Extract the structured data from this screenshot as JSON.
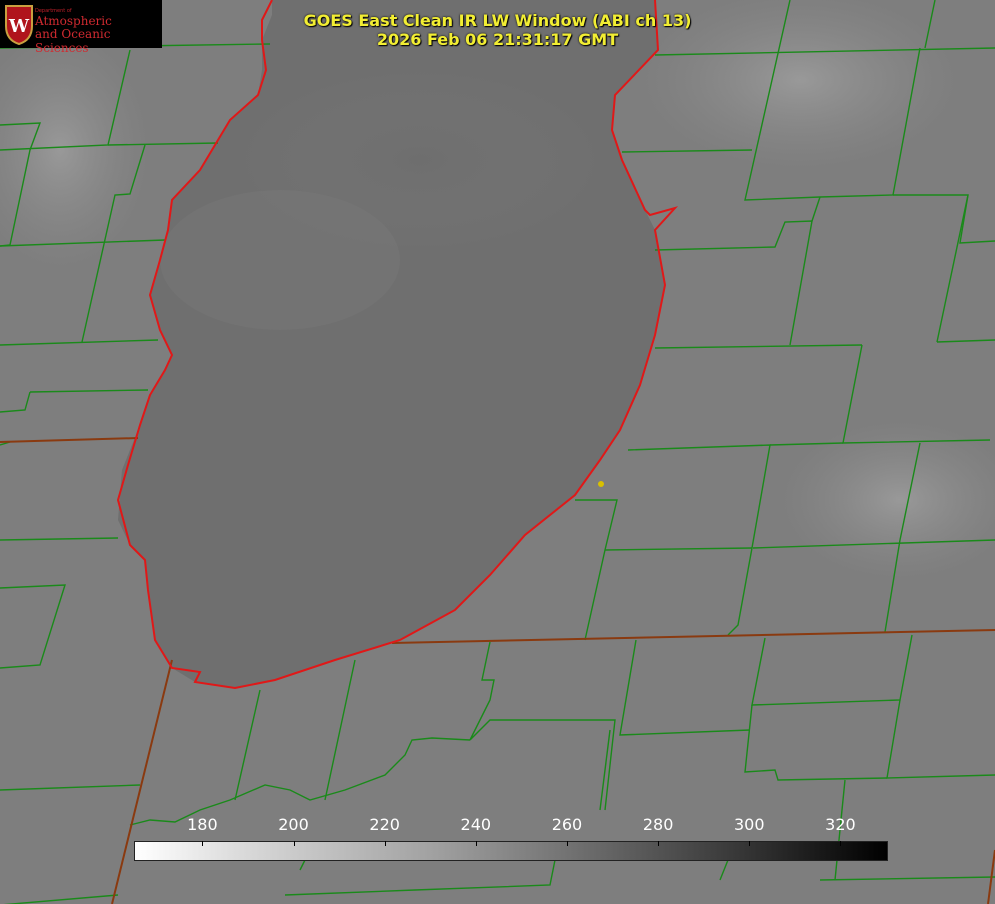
{
  "title": {
    "product": "GOES East Clean IR LW Window (ABI ch 13)",
    "timestamp": "2026 Feb 06 21:31:17 GMT"
  },
  "logo": {
    "dept": "Department of",
    "line1": "Atmospheric",
    "line2": "and Oceanic Sciences"
  },
  "colorbar": {
    "ticks": [
      "180",
      "200",
      "220",
      "240",
      "260",
      "280",
      "300",
      "320"
    ],
    "range": [
      165,
      330
    ],
    "colors": [
      "#ffffff",
      "#000000"
    ]
  },
  "colors": {
    "title": "#f2ee33",
    "shoreline": "#e01818",
    "county_border": "#1a8a1a",
    "state_border": "#8a3a10",
    "marker": "#d8c000"
  }
}
